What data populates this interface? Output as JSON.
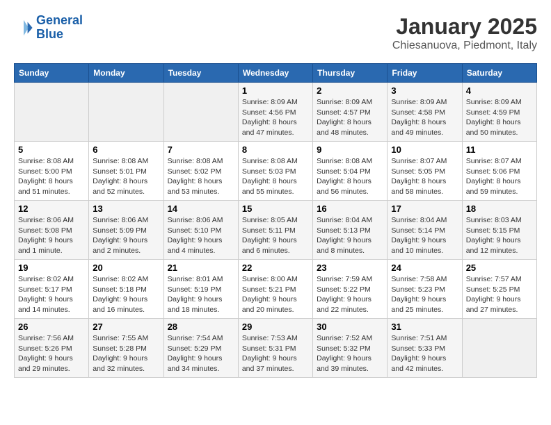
{
  "logo": {
    "line1": "General",
    "line2": "Blue"
  },
  "title": "January 2025",
  "subtitle": "Chiesanuova, Piedmont, Italy",
  "headers": [
    "Sunday",
    "Monday",
    "Tuesday",
    "Wednesday",
    "Thursday",
    "Friday",
    "Saturday"
  ],
  "weeks": [
    [
      {
        "num": "",
        "detail": ""
      },
      {
        "num": "",
        "detail": ""
      },
      {
        "num": "",
        "detail": ""
      },
      {
        "num": "1",
        "detail": "Sunrise: 8:09 AM\nSunset: 4:56 PM\nDaylight: 8 hours and 47 minutes."
      },
      {
        "num": "2",
        "detail": "Sunrise: 8:09 AM\nSunset: 4:57 PM\nDaylight: 8 hours and 48 minutes."
      },
      {
        "num": "3",
        "detail": "Sunrise: 8:09 AM\nSunset: 4:58 PM\nDaylight: 8 hours and 49 minutes."
      },
      {
        "num": "4",
        "detail": "Sunrise: 8:09 AM\nSunset: 4:59 PM\nDaylight: 8 hours and 50 minutes."
      }
    ],
    [
      {
        "num": "5",
        "detail": "Sunrise: 8:08 AM\nSunset: 5:00 PM\nDaylight: 8 hours and 51 minutes."
      },
      {
        "num": "6",
        "detail": "Sunrise: 8:08 AM\nSunset: 5:01 PM\nDaylight: 8 hours and 52 minutes."
      },
      {
        "num": "7",
        "detail": "Sunrise: 8:08 AM\nSunset: 5:02 PM\nDaylight: 8 hours and 53 minutes."
      },
      {
        "num": "8",
        "detail": "Sunrise: 8:08 AM\nSunset: 5:03 PM\nDaylight: 8 hours and 55 minutes."
      },
      {
        "num": "9",
        "detail": "Sunrise: 8:08 AM\nSunset: 5:04 PM\nDaylight: 8 hours and 56 minutes."
      },
      {
        "num": "10",
        "detail": "Sunrise: 8:07 AM\nSunset: 5:05 PM\nDaylight: 8 hours and 58 minutes."
      },
      {
        "num": "11",
        "detail": "Sunrise: 8:07 AM\nSunset: 5:06 PM\nDaylight: 8 hours and 59 minutes."
      }
    ],
    [
      {
        "num": "12",
        "detail": "Sunrise: 8:06 AM\nSunset: 5:08 PM\nDaylight: 9 hours and 1 minute."
      },
      {
        "num": "13",
        "detail": "Sunrise: 8:06 AM\nSunset: 5:09 PM\nDaylight: 9 hours and 2 minutes."
      },
      {
        "num": "14",
        "detail": "Sunrise: 8:06 AM\nSunset: 5:10 PM\nDaylight: 9 hours and 4 minutes."
      },
      {
        "num": "15",
        "detail": "Sunrise: 8:05 AM\nSunset: 5:11 PM\nDaylight: 9 hours and 6 minutes."
      },
      {
        "num": "16",
        "detail": "Sunrise: 8:04 AM\nSunset: 5:13 PM\nDaylight: 9 hours and 8 minutes."
      },
      {
        "num": "17",
        "detail": "Sunrise: 8:04 AM\nSunset: 5:14 PM\nDaylight: 9 hours and 10 minutes."
      },
      {
        "num": "18",
        "detail": "Sunrise: 8:03 AM\nSunset: 5:15 PM\nDaylight: 9 hours and 12 minutes."
      }
    ],
    [
      {
        "num": "19",
        "detail": "Sunrise: 8:02 AM\nSunset: 5:17 PM\nDaylight: 9 hours and 14 minutes."
      },
      {
        "num": "20",
        "detail": "Sunrise: 8:02 AM\nSunset: 5:18 PM\nDaylight: 9 hours and 16 minutes."
      },
      {
        "num": "21",
        "detail": "Sunrise: 8:01 AM\nSunset: 5:19 PM\nDaylight: 9 hours and 18 minutes."
      },
      {
        "num": "22",
        "detail": "Sunrise: 8:00 AM\nSunset: 5:21 PM\nDaylight: 9 hours and 20 minutes."
      },
      {
        "num": "23",
        "detail": "Sunrise: 7:59 AM\nSunset: 5:22 PM\nDaylight: 9 hours and 22 minutes."
      },
      {
        "num": "24",
        "detail": "Sunrise: 7:58 AM\nSunset: 5:23 PM\nDaylight: 9 hours and 25 minutes."
      },
      {
        "num": "25",
        "detail": "Sunrise: 7:57 AM\nSunset: 5:25 PM\nDaylight: 9 hours and 27 minutes."
      }
    ],
    [
      {
        "num": "26",
        "detail": "Sunrise: 7:56 AM\nSunset: 5:26 PM\nDaylight: 9 hours and 29 minutes."
      },
      {
        "num": "27",
        "detail": "Sunrise: 7:55 AM\nSunset: 5:28 PM\nDaylight: 9 hours and 32 minutes."
      },
      {
        "num": "28",
        "detail": "Sunrise: 7:54 AM\nSunset: 5:29 PM\nDaylight: 9 hours and 34 minutes."
      },
      {
        "num": "29",
        "detail": "Sunrise: 7:53 AM\nSunset: 5:31 PM\nDaylight: 9 hours and 37 minutes."
      },
      {
        "num": "30",
        "detail": "Sunrise: 7:52 AM\nSunset: 5:32 PM\nDaylight: 9 hours and 39 minutes."
      },
      {
        "num": "31",
        "detail": "Sunrise: 7:51 AM\nSunset: 5:33 PM\nDaylight: 9 hours and 42 minutes."
      },
      {
        "num": "",
        "detail": ""
      }
    ]
  ]
}
